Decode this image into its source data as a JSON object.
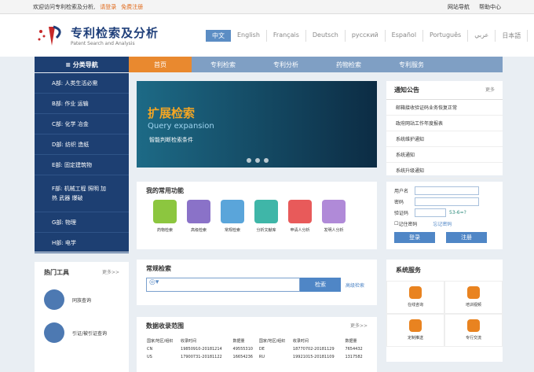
{
  "topbar": {
    "welcome": "欢迎访问专利检索及分析,",
    "login": "请登录",
    "register": "免费注册",
    "site_nav": "网站导航",
    "help": "帮助中心"
  },
  "logo": {
    "cn": "专利检索及分析",
    "en": "Patent Search and Analysis"
  },
  "langs": [
    "中文",
    "English",
    "Français",
    "Deutsch",
    "русский",
    "Español",
    "Português",
    "عربي",
    "日本語"
  ],
  "nav": {
    "category": "≡ 分类导航",
    "items": [
      "首页",
      "专利检索",
      "专利分析",
      "药物检索",
      "专利服务"
    ]
  },
  "side": [
    "A部: 人类生活必需",
    "B部: 作业 运输",
    "C部: 化学 冶金",
    "D部: 纺织 造纸",
    "E部: 固定建筑物",
    "F部: 机械工程 照明 加热 武器 爆破",
    "G部: 物理",
    "H部: 电学"
  ],
  "banner": {
    "title": "扩展检索",
    "subtitle": "Query expansion",
    "desc": "智能判断检索条件"
  },
  "notice": {
    "title": "通知公告",
    "more": "更多",
    "items": [
      "邮箱接收验证码业务恢复正常",
      "政府网站工作年度报表",
      "系统维护通知",
      "系统通知",
      "系统升级通知"
    ]
  },
  "funcs": {
    "title": "我的常用功能",
    "items": [
      "药物检索",
      "高级检索",
      "常规检索",
      "分析文献库",
      "申请人分析",
      "发明人分析"
    ],
    "colors": [
      "#8cc63f",
      "#8a72c8",
      "#5aa5da",
      "#3fb6a8",
      "#e85a5a",
      "#b08ad8"
    ]
  },
  "login": {
    "user_label": "用户名",
    "pwd_label": "密码",
    "code_label": "验证码",
    "code": "53-6=?",
    "remember": "记住密码",
    "forgot": "忘记密码",
    "login_btn": "登录",
    "register_btn": "注册"
  },
  "hot": {
    "title": "热门工具",
    "more": "更多>>",
    "tools": [
      "同族查询",
      "引证/被引证查询"
    ]
  },
  "search": {
    "title": "常规检索",
    "btn": "检索",
    "advanced": "高级检索"
  },
  "scope": {
    "title": "数据收录范围",
    "more": "更多>>",
    "headers": [
      "国家/地区/组织",
      "收录时间",
      "数据量",
      "国家/地区/组织",
      "收录时间",
      "数据量"
    ],
    "rows": [
      [
        "CN",
        "19850910-20181214",
        "49555310",
        "DE",
        "18770702-20181129",
        "7654432"
      ],
      [
        "US",
        "17900731-20181122",
        "16654236",
        "RU",
        "19921015-20181109",
        "1317582"
      ]
    ]
  },
  "svc": {
    "title": "系统服务",
    "items": [
      "在线咨询",
      "培训视频",
      "定制推送",
      "专行交流"
    ]
  }
}
